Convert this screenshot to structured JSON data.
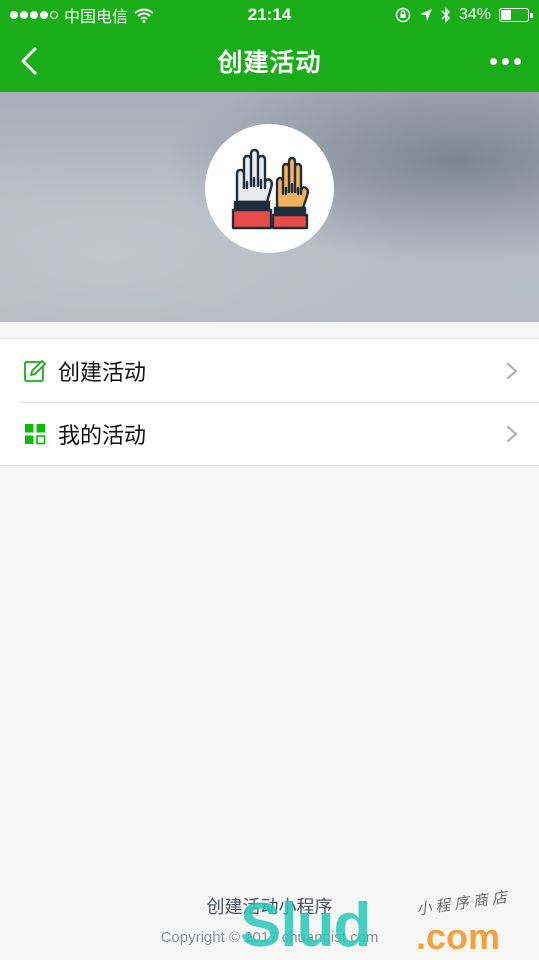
{
  "status_bar": {
    "carrier": "中国电信",
    "time": "21:14",
    "battery_percent": "34%",
    "battery_level": 0.34,
    "icons": [
      "signal-dots-icon",
      "wifi-icon",
      "orientation-lock-icon",
      "location-arrow-icon",
      "bluetooth-icon",
      "battery-icon"
    ]
  },
  "navbar": {
    "title": "创建活动",
    "back_icon": "chevron-left-icon",
    "more_icon": "more-dots-icon"
  },
  "banner": {
    "avatar_icon": "raised-hands-icon"
  },
  "menu": {
    "items": [
      {
        "label": "创建活动",
        "icon": "edit-icon"
      },
      {
        "label": "我的活动",
        "icon": "grid-icon"
      }
    ]
  },
  "footer": {
    "title": "创建活动小程序",
    "copyright": "Copyright © 2017 chuangist.com"
  },
  "watermark": {
    "text": "Slud",
    "domain": ".com",
    "cn": "小程序商店"
  },
  "colors": {
    "brand_green": "#1aad19",
    "grid_icon_green": "#09bb07",
    "background": "#f7f7f7"
  }
}
